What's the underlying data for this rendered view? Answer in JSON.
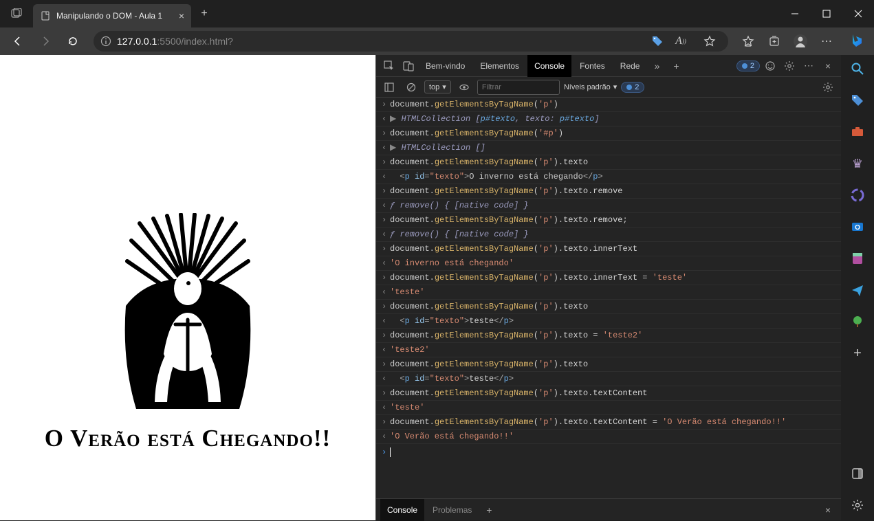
{
  "window": {
    "tab_title": "Manipulando o DOM - Aula 1"
  },
  "address": {
    "host": "127.0.0.1",
    "port_path": ":5500/index.html?"
  },
  "page": {
    "heading": "O Verão está Chegando!!"
  },
  "devtools": {
    "tabs": {
      "welcome": "Bem-vindo",
      "elements": "Elementos",
      "console": "Console",
      "sources": "Fontes",
      "network": "Rede"
    },
    "issue_count": "2",
    "filter_placeholder": "Filtrar",
    "context": "top",
    "levels": "Níveis padrão",
    "filter_count": "2",
    "drawer": {
      "console": "Console",
      "problems": "Problemas"
    },
    "log": [
      {
        "p": ">",
        "html": "document.<span class=\"c-fn\">getElementsByTagName</span>(<span class=\"c-str\">'p'</span>)"
      },
      {
        "p": "<",
        "html": "<span class=\"tri\">▶</span> <span class=\"c-dim\">HTMLCollection [<span class=\"c-tag\">p#texto</span>, texto: <span class=\"c-tag\">p#texto</span>]</span>"
      },
      {
        "p": ">",
        "html": "document.<span class=\"c-fn\">getElementsByTagName</span>(<span class=\"c-str\">'#p'</span>)"
      },
      {
        "p": "<",
        "html": "<span class=\"tri\">▶</span> <span class=\"c-dim\">HTMLCollection []</span>"
      },
      {
        "p": ">",
        "html": "document.<span class=\"c-fn\">getElementsByTagName</span>(<span class=\"c-str\">'p'</span>).<span class=\"c-prop\">texto</span>"
      },
      {
        "p": "<",
        "html": "  <span class=\"c-gray\">&lt;</span><span class=\"c-tag\">p</span> <span class=\"c-attr\">id</span><span class=\"c-gray\">=</span><span class=\"c-val\">\"texto\"</span><span class=\"c-gray\">&gt;</span>O inverno está chegando<span class=\"c-gray\">&lt;/</span><span class=\"c-tag\">p</span><span class=\"c-gray\">&gt;</span>"
      },
      {
        "p": ">",
        "html": "document.<span class=\"c-fn\">getElementsByTagName</span>(<span class=\"c-str\">'p'</span>).<span class=\"c-prop\">texto</span>.<span class=\"c-prop\">remove</span>"
      },
      {
        "p": "<",
        "html": "<span class=\"c-dim\">ƒ remove() { [native code] }</span>"
      },
      {
        "p": ">",
        "html": "document.<span class=\"c-fn\">getElementsByTagName</span>(<span class=\"c-str\">'p'</span>).<span class=\"c-prop\">texto</span>.<span class=\"c-prop\">remove</span>;"
      },
      {
        "p": "<",
        "html": "<span class=\"c-dim\">ƒ remove() { [native code] }</span>"
      },
      {
        "p": ">",
        "html": "document.<span class=\"c-fn\">getElementsByTagName</span>(<span class=\"c-str\">'p'</span>).<span class=\"c-prop\">texto</span>.<span class=\"c-prop\">innerText</span>"
      },
      {
        "p": "<",
        "html": "<span class=\"c-str\">'O inverno está chegando'</span>"
      },
      {
        "p": ">",
        "html": "document.<span class=\"c-fn\">getElementsByTagName</span>(<span class=\"c-str\">'p'</span>).<span class=\"c-prop\">texto</span>.<span class=\"c-prop\">innerText</span> = <span class=\"c-str\">'teste'</span>"
      },
      {
        "p": "<",
        "html": "<span class=\"c-str\">'teste'</span>"
      },
      {
        "p": ">",
        "html": "document.<span class=\"c-fn\">getElementsByTagName</span>(<span class=\"c-str\">'p'</span>).<span class=\"c-prop\">texto</span>"
      },
      {
        "p": "<",
        "html": "  <span class=\"c-gray\">&lt;</span><span class=\"c-tag\">p</span> <span class=\"c-attr\">id</span><span class=\"c-gray\">=</span><span class=\"c-val\">\"texto\"</span><span class=\"c-gray\">&gt;</span>teste<span class=\"c-gray\">&lt;/</span><span class=\"c-tag\">p</span><span class=\"c-gray\">&gt;</span>"
      },
      {
        "p": ">",
        "html": "document.<span class=\"c-fn\">getElementsByTagName</span>(<span class=\"c-str\">'p'</span>).<span class=\"c-prop\">texto</span> = <span class=\"c-str\">'teste2'</span>"
      },
      {
        "p": "<",
        "html": "<span class=\"c-str\">'teste2'</span>"
      },
      {
        "p": ">",
        "html": "document.<span class=\"c-fn\">getElementsByTagName</span>(<span class=\"c-str\">'p'</span>).<span class=\"c-prop\">texto</span>"
      },
      {
        "p": "<",
        "html": "  <span class=\"c-gray\">&lt;</span><span class=\"c-tag\">p</span> <span class=\"c-attr\">id</span><span class=\"c-gray\">=</span><span class=\"c-val\">\"texto\"</span><span class=\"c-gray\">&gt;</span>teste<span class=\"c-gray\">&lt;/</span><span class=\"c-tag\">p</span><span class=\"c-gray\">&gt;</span>"
      },
      {
        "p": ">",
        "html": "document.<span class=\"c-fn\">getElementsByTagName</span>(<span class=\"c-str\">'p'</span>).<span class=\"c-prop\">texto</span>.<span class=\"c-prop\">textContent</span>"
      },
      {
        "p": "<",
        "html": "<span class=\"c-str\">'teste'</span>"
      },
      {
        "p": ">",
        "html": "document.<span class=\"c-fn\">getElementsByTagName</span>(<span class=\"c-str\">'p'</span>).<span class=\"c-prop\">texto</span>.<span class=\"c-prop\">textContent</span> = <span class=\"c-str\">'O Verão está chegando!!'</span>"
      },
      {
        "p": "<",
        "html": "<span class=\"c-str\">'O Verão está chegando!!'</span>"
      }
    ]
  }
}
